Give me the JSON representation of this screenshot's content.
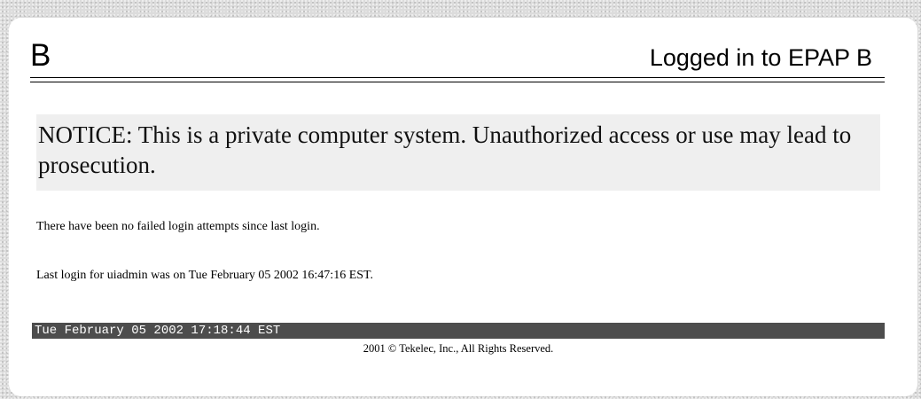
{
  "header": {
    "letter": "B",
    "title": "Logged in to EPAP B"
  },
  "notice": {
    "text": "NOTICE: This is a private computer system. Unauthorized access or use may lead to prosecution."
  },
  "messages": {
    "failed_logins": "There have been no failed login attempts since last login.",
    "last_login": "Last login for uiadmin was on Tue February 05 2002 16:47:16 EST."
  },
  "status_bar": {
    "datetime": "Tue February 05 2002 17:18:44 EST"
  },
  "footer": {
    "copyright": "2001 © Tekelec, Inc., All Rights Reserved."
  },
  "colors": {
    "background": "#dcdcdc",
    "panel": "#ffffff",
    "notice_bg": "#efefef",
    "status_bar_bg": "#4d4d4d",
    "status_bar_text": "#ffffff"
  }
}
